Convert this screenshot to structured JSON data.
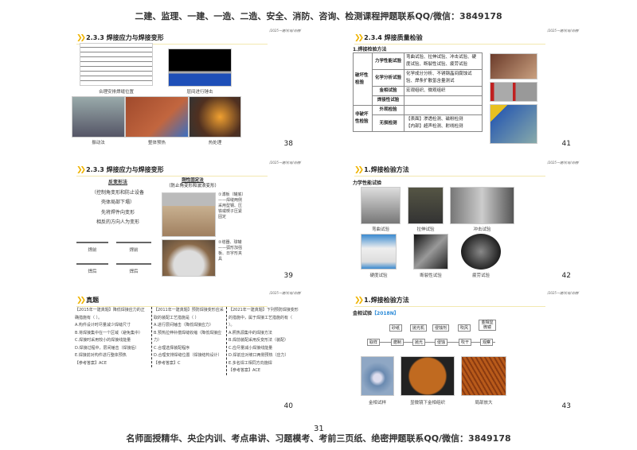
{
  "header": "二建、监理、一建、一造、二造、安全、消防、咨询、检测课程押题联系QQ/微信：3849178",
  "footer": "名师面授精华、央企内训、考点串讲、习题模考、考前三页纸、绝密押题联系QQ/微信：3849178",
  "page_number": "31",
  "slide_tag": "/2025一建/机电/尚德/",
  "slides": {
    "s38": {
      "title": "2.3.3 焊接应力与焊接变形",
      "captions": [
        "合理安排焊缝位置",
        "层间进行锤击",
        "振动法",
        "整体预热",
        "热处理"
      ],
      "num": "38"
    },
    "s41": {
      "title": "2.3.4 焊接质量检验",
      "subtitle": "1.焊接检验方法",
      "destructive": "破坏性检验",
      "nondestructive": "非破坏性检验",
      "rows": [
        {
          "k": "力学性能试验",
          "v": "弯曲试验、拉伸试验、冲击试验、硬度试验、断裂性试验、疲劳试验"
        },
        {
          "k": "化学分析试验",
          "v": "化学成分分析、不锈钢晶间腐蚀试验、焊条扩散氢含量测试"
        },
        {
          "k": "金相试验",
          "v": "宏观组织、微观组织"
        },
        {
          "k": "焊接性试验",
          "v": ""
        },
        {
          "k": "外观检验",
          "v": ""
        },
        {
          "k": "无损检测",
          "v": "【表面】渗透检测、磁粉检测",
          "v2": "【内部】超声检测、射线检测"
        }
      ],
      "num": "41"
    },
    "s39": {
      "title": "2.3.3 焊接应力与焊接变形",
      "left_head": "反变形法",
      "left_lines": [
        "（控制角变形和防止设备",
        "壳体局部下塌）",
        "先将焊件向变形",
        "相反的方向人为变形"
      ],
      "labels": [
        "焊前",
        "焊前",
        "焊后",
        "焊后"
      ],
      "right_head": "刚性固定法",
      "right_sub": "（防止角变形和波浪变形）",
      "note1": "①溥板（罐底）——焊缝两侧采用型钢、压铁或楔子压紧固定",
      "note2": "②塔器、球罐——弧形加强板、日字形夹具",
      "num": "39"
    },
    "s42": {
      "title": "1.焊接检验方法",
      "subtitle": "力学性能试验",
      "captions": [
        "弯曲试验",
        "拉伸试验",
        "冲击试验",
        "硬度试验",
        "断裂性试验",
        "疲劳试验"
      ],
      "num": "42"
    },
    "s40": {
      "title": "真题",
      "cols": [
        [
          "【2015年一建真题】降低焊接应力的正确措施有（ ）。",
          "A.构件设计时尽量减少焊缝尺寸",
          "B.将焊接集中在一个区域（避免集中）",
          "C.焊接时采用较小的焊接线能量",
          "D.焊接过程中，层间锤击（焊接后）",
          "E.焊接前对构件进行整体预热",
          "【参考答案】ACE"
        ],
        [
          "【2011年一建真题】预防焊接变形应采取的装配工艺措施是（ ）",
          "A.进行层间锤击（降低焊接应力）",
          "B.预热拉伸补偿焊缝收缩（降低焊接应力）",
          "C.合理选择装配程序",
          "D.合理安排焊缝位置（焊接结构设计）",
          "",
          "【参考答案】C"
        ],
        [
          "【2021年一建真题】下列预防焊接变形的措施中，属于焊接工艺措施的有（ ）。",
          "A.照热源集中的焊接方法",
          "B.焊前装配采用反变形法（装配）",
          "C.应尽量减小焊接线能量",
          "D.焊前应对坡口两侧预热（应力）",
          "E.多名焊工相同方向施焊",
          "【参考答案】ACE"
        ]
      ],
      "num": "40"
    },
    "s43": {
      "title": "1.焊接检验方法",
      "subtitle": "金相试验",
      "year": "【2018N】",
      "tools": [
        "砂纸",
        "抛光机",
        "侵蚀剂",
        "吹风",
        "金相显微镜"
      ],
      "steps": [
        "取样",
        "磨制",
        "抛光",
        "侵蚀",
        "吹干",
        "观察"
      ],
      "captions": [
        "金相试样",
        "显微镜下金相组织",
        "局部放大"
      ],
      "num": "43"
    }
  }
}
